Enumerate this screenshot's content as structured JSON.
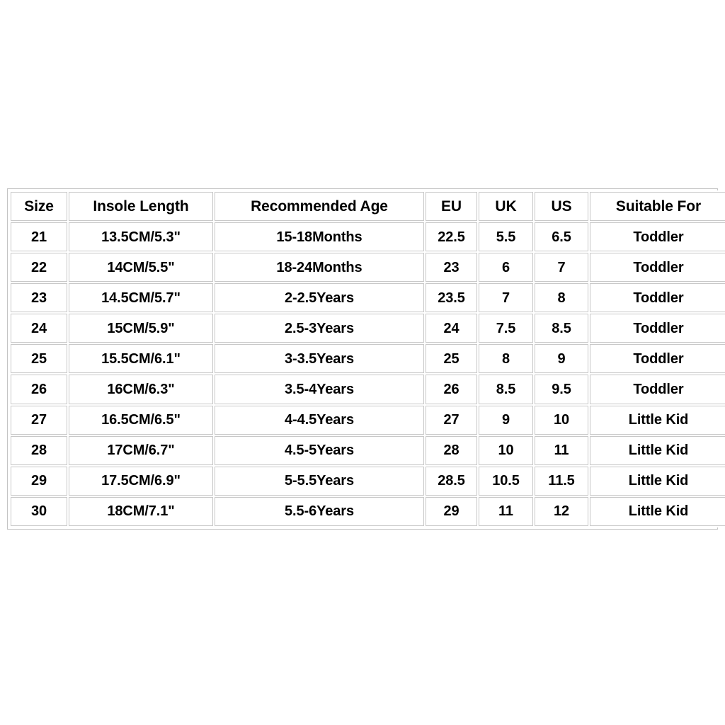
{
  "table": {
    "name": "children-shoe-size-chart",
    "headers": [
      "Size",
      "Insole Length",
      "Recommended Age",
      "EU",
      "UK",
      "US",
      "Suitable For"
    ],
    "rows": [
      [
        "21",
        "13.5CM/5.3\"",
        "15-18Months",
        "22.5",
        "5.5",
        "6.5",
        "Toddler"
      ],
      [
        "22",
        "14CM/5.5\"",
        "18-24Months",
        "23",
        "6",
        "7",
        "Toddler"
      ],
      [
        "23",
        "14.5CM/5.7\"",
        "2-2.5Years",
        "23.5",
        "7",
        "8",
        "Toddler"
      ],
      [
        "24",
        "15CM/5.9\"",
        "2.5-3Years",
        "24",
        "7.5",
        "8.5",
        "Toddler"
      ],
      [
        "25",
        "15.5CM/6.1\"",
        "3-3.5Years",
        "25",
        "8",
        "9",
        "Toddler"
      ],
      [
        "26",
        "16CM/6.3\"",
        "3.5-4Years",
        "26",
        "8.5",
        "9.5",
        "Toddler"
      ],
      [
        "27",
        "16.5CM/6.5\"",
        "4-4.5Years",
        "27",
        "9",
        "10",
        "Little Kid"
      ],
      [
        "28",
        "17CM/6.7\"",
        "4.5-5Years",
        "28",
        "10",
        "11",
        "Little Kid"
      ],
      [
        "29",
        "17.5CM/6.9\"",
        "5-5.5Years",
        "28.5",
        "10.5",
        "11.5",
        "Little Kid"
      ],
      [
        "30",
        "18CM/7.1\"",
        "5.5-6Years",
        "29",
        "11",
        "12",
        "Little Kid"
      ]
    ]
  },
  "colors": {
    "background": "#ffffff",
    "cell_border": "#c8c8c8",
    "outer_border": "#c4c4c4",
    "text": "#000000"
  }
}
